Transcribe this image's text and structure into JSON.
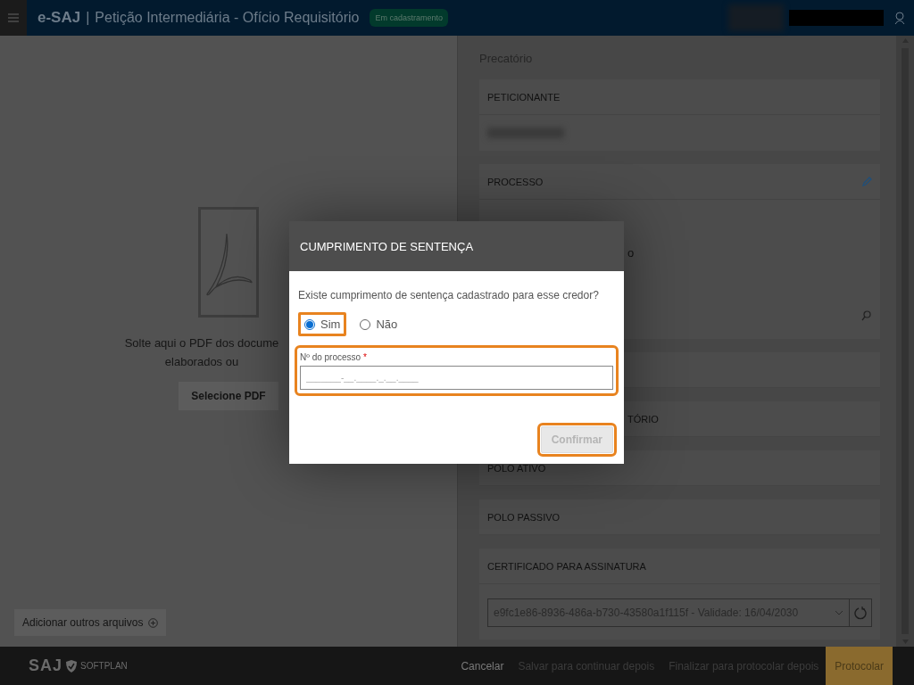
{
  "header": {
    "brand": "e-SAJ",
    "separator": "|",
    "title": "Petição Intermediária - Ofício Requisitório",
    "status": "Em cadastramento"
  },
  "upload": {
    "drop_text": [
      "Solte aqui o PDF dos docume",
      "elaborados ou"
    ],
    "select_button": "Selecione PDF",
    "add_files_button": "Adicionar outros arquivos"
  },
  "panel": {
    "title": "Precatório",
    "sections": [
      {
        "kind": "redacted",
        "header": "PETICIONANTE"
      },
      {
        "kind": "search",
        "header": "PROCESSO",
        "editable": true,
        "body_text": "o"
      },
      {
        "kind": "covered"
      },
      {
        "kind": "covered",
        "header": "TÓRIO"
      },
      {
        "kind": "plain",
        "header": "POLO ATIVO"
      },
      {
        "kind": "plain",
        "header": "POLO PASSIVO"
      },
      {
        "kind": "select",
        "header": "CERTIFICADO PARA ASSINATURA",
        "value": "e9fc1e86-8936-486a-b730-43580a1f115f - Validade: 16/04/2030"
      }
    ]
  },
  "footer": {
    "logo": "SAJ",
    "brand": "SOFTPLAN",
    "actions": [
      {
        "label": "Cancelar",
        "kind": "link",
        "disabled": false
      },
      {
        "label": "Salvar para continuar depois",
        "kind": "link",
        "disabled": true
      },
      {
        "label": "Finalizar para protocolar depois",
        "kind": "link",
        "disabled": true
      },
      {
        "label": "Protocolar",
        "kind": "primary",
        "disabled": false
      }
    ]
  },
  "modal": {
    "title": "CUMPRIMENTO DE SENTENÇA",
    "question": "Existe cumprimento de sentença cadastrado para esse credor?",
    "options": [
      {
        "label": "Sim",
        "selected": true,
        "highlighted": true
      },
      {
        "label": "Não",
        "selected": false,
        "highlighted": false
      }
    ],
    "field": {
      "label": "Nº do processo",
      "required_mark": "*",
      "placeholder": "_______-__.____._.__.____",
      "highlighted": true
    },
    "confirm": {
      "label": "Confirmar",
      "disabled": true,
      "highlighted": true
    }
  }
}
